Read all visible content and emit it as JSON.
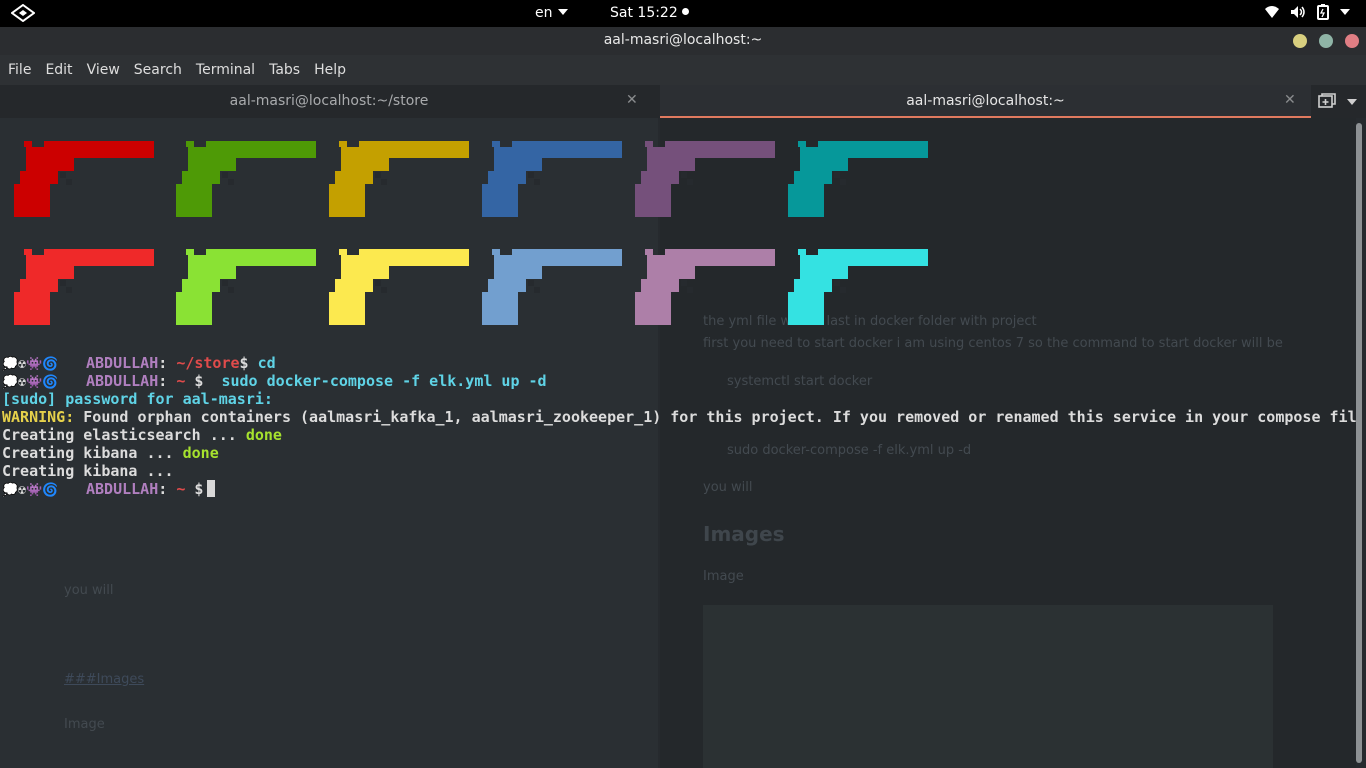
{
  "topbar": {
    "language": "en",
    "clock": "Sat 15:22"
  },
  "window": {
    "title": "aal-masri@localhost:~"
  },
  "menu": [
    "File",
    "Edit",
    "View",
    "Search",
    "Terminal",
    "Tabs",
    "Help"
  ],
  "tabs": [
    {
      "label": "aal-masri@localhost:~/store",
      "active": false
    },
    {
      "label": "aal-masri@localhost:~",
      "active": true
    }
  ],
  "colors": {
    "row1": [
      "#cc0000",
      "#4e9a06",
      "#c4a000",
      "#3465a4",
      "#75507b",
      "#06989a"
    ],
    "row2": [
      "#ef2929",
      "#8ae234",
      "#fce94f",
      "#729fcf",
      "#ad7fa8",
      "#34e2e2"
    ]
  },
  "terminal": {
    "prompt_emoji": "💭☢👾🌀",
    "user": "ABDULLAH",
    "sep": ":",
    "line1": {
      "path": "~/store",
      "symbol": "$",
      "command": " cd"
    },
    "line2": {
      "path": "~",
      "symbol": "$",
      "command": "  sudo docker-compose -f elk.yml up -d"
    },
    "line3": "[sudo] password for aal-masri:",
    "line4": {
      "prefix": "WARNING:",
      "text": " Found orphan containers (aalmasri_kafka_1, aalmasri_zookeeper_1) for this project. If you removed or renamed this service in your compose fil"
    },
    "line5": {
      "text": "Creating elasticsearch ... ",
      "status": "done"
    },
    "line6": {
      "text": "Creating kibana ... ",
      "status": "done"
    },
    "line7": "Creating kibana ...",
    "line8": {
      "path": "~",
      "symbol": "$"
    }
  },
  "background_text": {
    "right": [
      "the yml file will be last in docker folder with project",
      "first you need to start docker i am using centos 7 so the command to start docker will be",
      "systemctl start docker",
      "sudo docker-compose -f elk.yml up -d",
      "you will",
      "Images",
      "Image"
    ],
    "left": [
      "you will",
      "###Images",
      "Image"
    ]
  }
}
